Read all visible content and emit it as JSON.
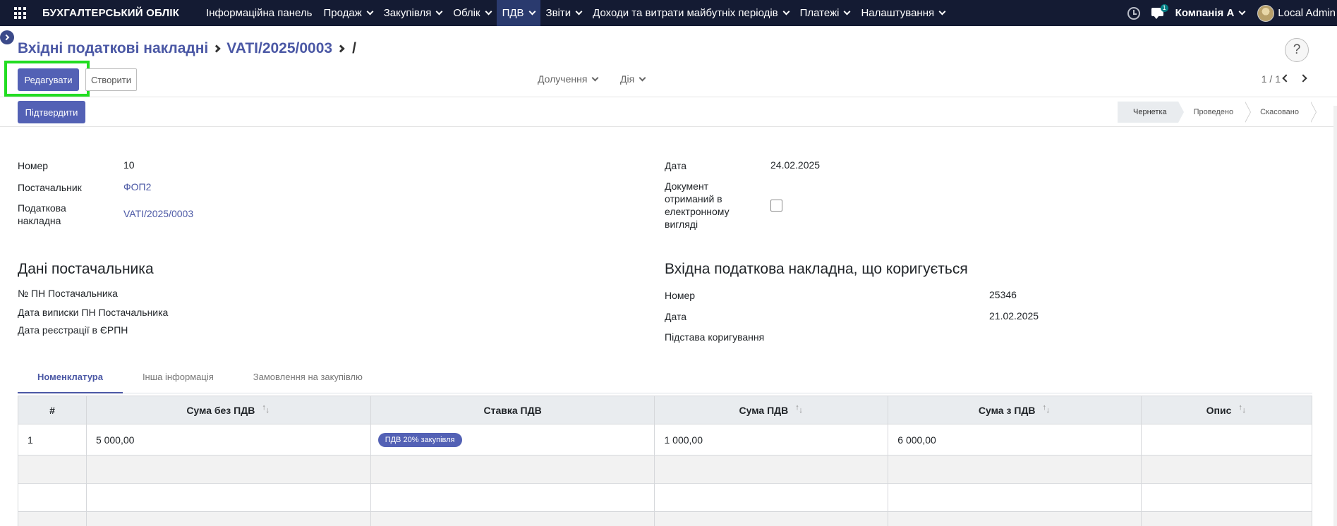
{
  "navbar": {
    "brand": "БУХГАЛТЕРСЬКИЙ ОБЛІК",
    "menu": [
      {
        "label": "Інформаційна панель",
        "has_dropdown": false
      },
      {
        "label": "Продаж",
        "has_dropdown": true
      },
      {
        "label": "Закупівля",
        "has_dropdown": true
      },
      {
        "label": "Облік",
        "has_dropdown": true
      },
      {
        "label": "ПДВ",
        "has_dropdown": true,
        "active": true
      },
      {
        "label": "Звіти",
        "has_dropdown": true
      },
      {
        "label": "Доходи та витрати майбутніх періодів",
        "has_dropdown": true
      },
      {
        "label": "Платежі",
        "has_dropdown": true
      },
      {
        "label": "Налаштування",
        "has_dropdown": true
      }
    ],
    "chat_badge": "1",
    "company": "Компанія А",
    "user": "Local Admin",
    "bg_color": "#141b33"
  },
  "breadcrumb": {
    "parent": "Вхідні податкові накладні",
    "current": "VATI/2025/0003",
    "trailing": "/"
  },
  "help_label": "?",
  "controls": {
    "edit_label": "Редагувати",
    "create_label": "Створити",
    "attachment_label": "Долучення",
    "action_label": "Дія",
    "pager": "1 / 1"
  },
  "status": {
    "confirm_label": "Підтвердити",
    "stages": [
      "Чернетка",
      "Проведено",
      "Скасовано"
    ],
    "current_stage": "Чернетка"
  },
  "form": {
    "number_label": "Номер",
    "number_value": "10",
    "supplier_label": "Постачальник",
    "supplier_value": "ФОП2",
    "tax_invoice_label": "Податкова накладна",
    "tax_invoice_value": "VATI/2025/0003",
    "date_label": "Дата",
    "date_value": "24.02.2025",
    "electronic_label": "Документ отриманий в електронному вигляді",
    "electronic_checked": false
  },
  "supplier_section": {
    "title": "Дані постачальника",
    "fields": [
      "№ ПН Постачальника",
      "Дата виписки ПН Постачальника",
      "Дата реєстрації в ЄРПН"
    ]
  },
  "corrected_section": {
    "title": "Вхідна податкова накладна, що коригується",
    "number_label": "Номер",
    "number_value": "25346",
    "date_label": "Дата",
    "date_value": "21.02.2025",
    "reason_label": "Підстава коригування"
  },
  "tabs": [
    "Номенклатура",
    "Інша інформація",
    "Замовлення на закупівлю"
  ],
  "active_tab": "Номенклатура",
  "table": {
    "headers": [
      "#",
      "Сума без ПДВ",
      "Ставка ПДВ",
      "Сума ПДВ",
      "Сума з ПДВ",
      "Опис"
    ],
    "rows": [
      {
        "num": "1",
        "amount_ex": "5 000,00",
        "rate": "ПДВ 20% закупівля",
        "vat": "1 000,00",
        "amount_inc": "6 000,00",
        "desc": ""
      }
    ]
  },
  "colors": {
    "accent": "#5361b5",
    "link": "#4b58a5",
    "highlight": "#22dd22"
  }
}
